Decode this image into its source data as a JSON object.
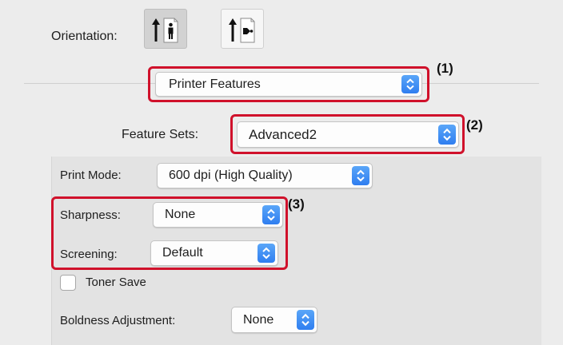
{
  "orientation": {
    "label": "Orientation:",
    "options": [
      {
        "name": "portrait",
        "selected": true
      },
      {
        "name": "landscape",
        "selected": false
      }
    ]
  },
  "panel_select": {
    "value": "Printer Features"
  },
  "feature_sets": {
    "label": "Feature Sets:",
    "value": "Advanced2"
  },
  "print_mode": {
    "label": "Print Mode:",
    "value": "600 dpi (High Quality)"
  },
  "sharpness": {
    "label": "Sharpness:",
    "value": "None"
  },
  "screening": {
    "label": "Screening:",
    "value": "Default"
  },
  "toner_save": {
    "label": "Toner Save",
    "checked": false
  },
  "boldness": {
    "label": "Boldness Adjustment:",
    "value": "None"
  },
  "callouts": {
    "c1": "(1)",
    "c2": "(2)",
    "c3": "(3)"
  },
  "colors": {
    "highlight": "#d0112b",
    "stepper": "#2f7ef0"
  },
  "icons": [
    "portrait-orientation-icon",
    "landscape-orientation-icon",
    "updown-chevron-icon"
  ]
}
